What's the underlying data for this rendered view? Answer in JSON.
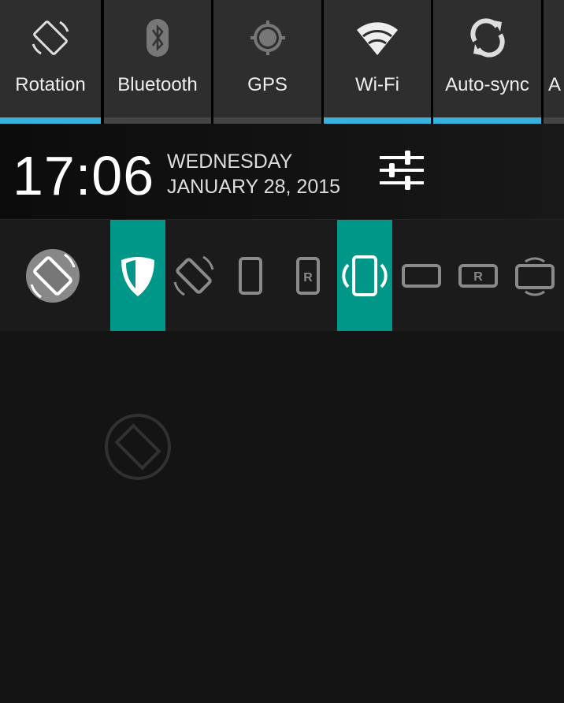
{
  "quick_settings": [
    {
      "label": "Rotation",
      "icon": "rotation-icon",
      "active": true
    },
    {
      "label": "Bluetooth",
      "icon": "bluetooth-icon",
      "active": false
    },
    {
      "label": "GPS",
      "icon": "gps-icon",
      "active": false
    },
    {
      "label": "Wi-Fi",
      "icon": "wifi-icon",
      "active": true
    },
    {
      "label": "Auto-sync",
      "icon": "sync-icon",
      "active": true
    },
    {
      "label": "A",
      "icon": "",
      "active": false
    }
  ],
  "header": {
    "time": "17:06",
    "day": "WEDNESDAY",
    "date": "JANUARY 28, 2015",
    "settings_icon": "settings-sliders-icon"
  },
  "rotation_options": [
    {
      "icon": "rotation-app-icon",
      "selected": false
    },
    {
      "icon": "shield-icon",
      "selected": true
    },
    {
      "icon": "auto-rotate-icon",
      "selected": false
    },
    {
      "icon": "portrait-icon",
      "selected": false
    },
    {
      "icon": "reverse-portrait-icon",
      "selected": false
    },
    {
      "icon": "sensor-portrait-icon",
      "selected": true
    },
    {
      "icon": "landscape-icon",
      "selected": false
    },
    {
      "icon": "reverse-landscape-icon",
      "selected": false
    },
    {
      "icon": "sensor-landscape-icon",
      "selected": false
    }
  ],
  "colors": {
    "accent_blue": "#35b3dc",
    "selected_teal": "#009688"
  }
}
